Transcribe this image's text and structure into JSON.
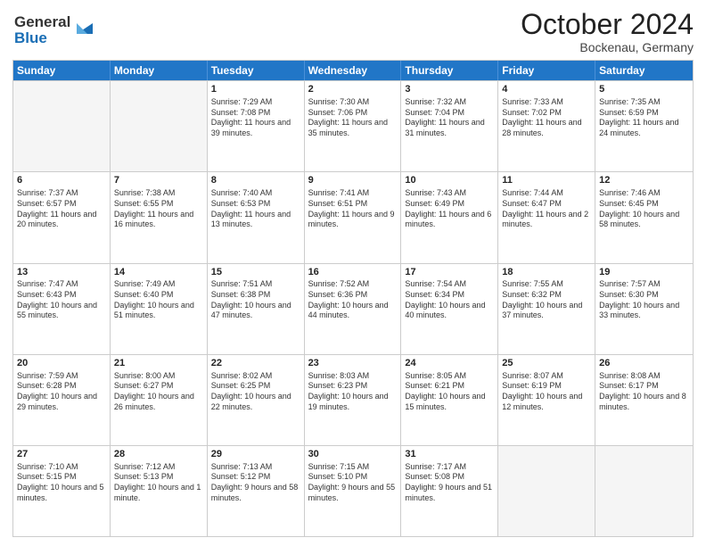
{
  "header": {
    "logo_line1": "General",
    "logo_line2": "Blue",
    "month": "October 2024",
    "location": "Bockenau, Germany"
  },
  "weekdays": [
    "Sunday",
    "Monday",
    "Tuesday",
    "Wednesday",
    "Thursday",
    "Friday",
    "Saturday"
  ],
  "weeks": [
    [
      {
        "day": "",
        "sunrise": "",
        "sunset": "",
        "daylight": "",
        "empty": true
      },
      {
        "day": "",
        "sunrise": "",
        "sunset": "",
        "daylight": "",
        "empty": true
      },
      {
        "day": "1",
        "sunrise": "Sunrise: 7:29 AM",
        "sunset": "Sunset: 7:08 PM",
        "daylight": "Daylight: 11 hours and 39 minutes.",
        "empty": false
      },
      {
        "day": "2",
        "sunrise": "Sunrise: 7:30 AM",
        "sunset": "Sunset: 7:06 PM",
        "daylight": "Daylight: 11 hours and 35 minutes.",
        "empty": false
      },
      {
        "day": "3",
        "sunrise": "Sunrise: 7:32 AM",
        "sunset": "Sunset: 7:04 PM",
        "daylight": "Daylight: 11 hours and 31 minutes.",
        "empty": false
      },
      {
        "day": "4",
        "sunrise": "Sunrise: 7:33 AM",
        "sunset": "Sunset: 7:02 PM",
        "daylight": "Daylight: 11 hours and 28 minutes.",
        "empty": false
      },
      {
        "day": "5",
        "sunrise": "Sunrise: 7:35 AM",
        "sunset": "Sunset: 6:59 PM",
        "daylight": "Daylight: 11 hours and 24 minutes.",
        "empty": false
      }
    ],
    [
      {
        "day": "6",
        "sunrise": "Sunrise: 7:37 AM",
        "sunset": "Sunset: 6:57 PM",
        "daylight": "Daylight: 11 hours and 20 minutes.",
        "empty": false
      },
      {
        "day": "7",
        "sunrise": "Sunrise: 7:38 AM",
        "sunset": "Sunset: 6:55 PM",
        "daylight": "Daylight: 11 hours and 16 minutes.",
        "empty": false
      },
      {
        "day": "8",
        "sunrise": "Sunrise: 7:40 AM",
        "sunset": "Sunset: 6:53 PM",
        "daylight": "Daylight: 11 hours and 13 minutes.",
        "empty": false
      },
      {
        "day": "9",
        "sunrise": "Sunrise: 7:41 AM",
        "sunset": "Sunset: 6:51 PM",
        "daylight": "Daylight: 11 hours and 9 minutes.",
        "empty": false
      },
      {
        "day": "10",
        "sunrise": "Sunrise: 7:43 AM",
        "sunset": "Sunset: 6:49 PM",
        "daylight": "Daylight: 11 hours and 6 minutes.",
        "empty": false
      },
      {
        "day": "11",
        "sunrise": "Sunrise: 7:44 AM",
        "sunset": "Sunset: 6:47 PM",
        "daylight": "Daylight: 11 hours and 2 minutes.",
        "empty": false
      },
      {
        "day": "12",
        "sunrise": "Sunrise: 7:46 AM",
        "sunset": "Sunset: 6:45 PM",
        "daylight": "Daylight: 10 hours and 58 minutes.",
        "empty": false
      }
    ],
    [
      {
        "day": "13",
        "sunrise": "Sunrise: 7:47 AM",
        "sunset": "Sunset: 6:43 PM",
        "daylight": "Daylight: 10 hours and 55 minutes.",
        "empty": false
      },
      {
        "day": "14",
        "sunrise": "Sunrise: 7:49 AM",
        "sunset": "Sunset: 6:40 PM",
        "daylight": "Daylight: 10 hours and 51 minutes.",
        "empty": false
      },
      {
        "day": "15",
        "sunrise": "Sunrise: 7:51 AM",
        "sunset": "Sunset: 6:38 PM",
        "daylight": "Daylight: 10 hours and 47 minutes.",
        "empty": false
      },
      {
        "day": "16",
        "sunrise": "Sunrise: 7:52 AM",
        "sunset": "Sunset: 6:36 PM",
        "daylight": "Daylight: 10 hours and 44 minutes.",
        "empty": false
      },
      {
        "day": "17",
        "sunrise": "Sunrise: 7:54 AM",
        "sunset": "Sunset: 6:34 PM",
        "daylight": "Daylight: 10 hours and 40 minutes.",
        "empty": false
      },
      {
        "day": "18",
        "sunrise": "Sunrise: 7:55 AM",
        "sunset": "Sunset: 6:32 PM",
        "daylight": "Daylight: 10 hours and 37 minutes.",
        "empty": false
      },
      {
        "day": "19",
        "sunrise": "Sunrise: 7:57 AM",
        "sunset": "Sunset: 6:30 PM",
        "daylight": "Daylight: 10 hours and 33 minutes.",
        "empty": false
      }
    ],
    [
      {
        "day": "20",
        "sunrise": "Sunrise: 7:59 AM",
        "sunset": "Sunset: 6:28 PM",
        "daylight": "Daylight: 10 hours and 29 minutes.",
        "empty": false
      },
      {
        "day": "21",
        "sunrise": "Sunrise: 8:00 AM",
        "sunset": "Sunset: 6:27 PM",
        "daylight": "Daylight: 10 hours and 26 minutes.",
        "empty": false
      },
      {
        "day": "22",
        "sunrise": "Sunrise: 8:02 AM",
        "sunset": "Sunset: 6:25 PM",
        "daylight": "Daylight: 10 hours and 22 minutes.",
        "empty": false
      },
      {
        "day": "23",
        "sunrise": "Sunrise: 8:03 AM",
        "sunset": "Sunset: 6:23 PM",
        "daylight": "Daylight: 10 hours and 19 minutes.",
        "empty": false
      },
      {
        "day": "24",
        "sunrise": "Sunrise: 8:05 AM",
        "sunset": "Sunset: 6:21 PM",
        "daylight": "Daylight: 10 hours and 15 minutes.",
        "empty": false
      },
      {
        "day": "25",
        "sunrise": "Sunrise: 8:07 AM",
        "sunset": "Sunset: 6:19 PM",
        "daylight": "Daylight: 10 hours and 12 minutes.",
        "empty": false
      },
      {
        "day": "26",
        "sunrise": "Sunrise: 8:08 AM",
        "sunset": "Sunset: 6:17 PM",
        "daylight": "Daylight: 10 hours and 8 minutes.",
        "empty": false
      }
    ],
    [
      {
        "day": "27",
        "sunrise": "Sunrise: 7:10 AM",
        "sunset": "Sunset: 5:15 PM",
        "daylight": "Daylight: 10 hours and 5 minutes.",
        "empty": false
      },
      {
        "day": "28",
        "sunrise": "Sunrise: 7:12 AM",
        "sunset": "Sunset: 5:13 PM",
        "daylight": "Daylight: 10 hours and 1 minute.",
        "empty": false
      },
      {
        "day": "29",
        "sunrise": "Sunrise: 7:13 AM",
        "sunset": "Sunset: 5:12 PM",
        "daylight": "Daylight: 9 hours and 58 minutes.",
        "empty": false
      },
      {
        "day": "30",
        "sunrise": "Sunrise: 7:15 AM",
        "sunset": "Sunset: 5:10 PM",
        "daylight": "Daylight: 9 hours and 55 minutes.",
        "empty": false
      },
      {
        "day": "31",
        "sunrise": "Sunrise: 7:17 AM",
        "sunset": "Sunset: 5:08 PM",
        "daylight": "Daylight: 9 hours and 51 minutes.",
        "empty": false
      },
      {
        "day": "",
        "sunrise": "",
        "sunset": "",
        "daylight": "",
        "empty": true
      },
      {
        "day": "",
        "sunrise": "",
        "sunset": "",
        "daylight": "",
        "empty": true
      }
    ]
  ]
}
